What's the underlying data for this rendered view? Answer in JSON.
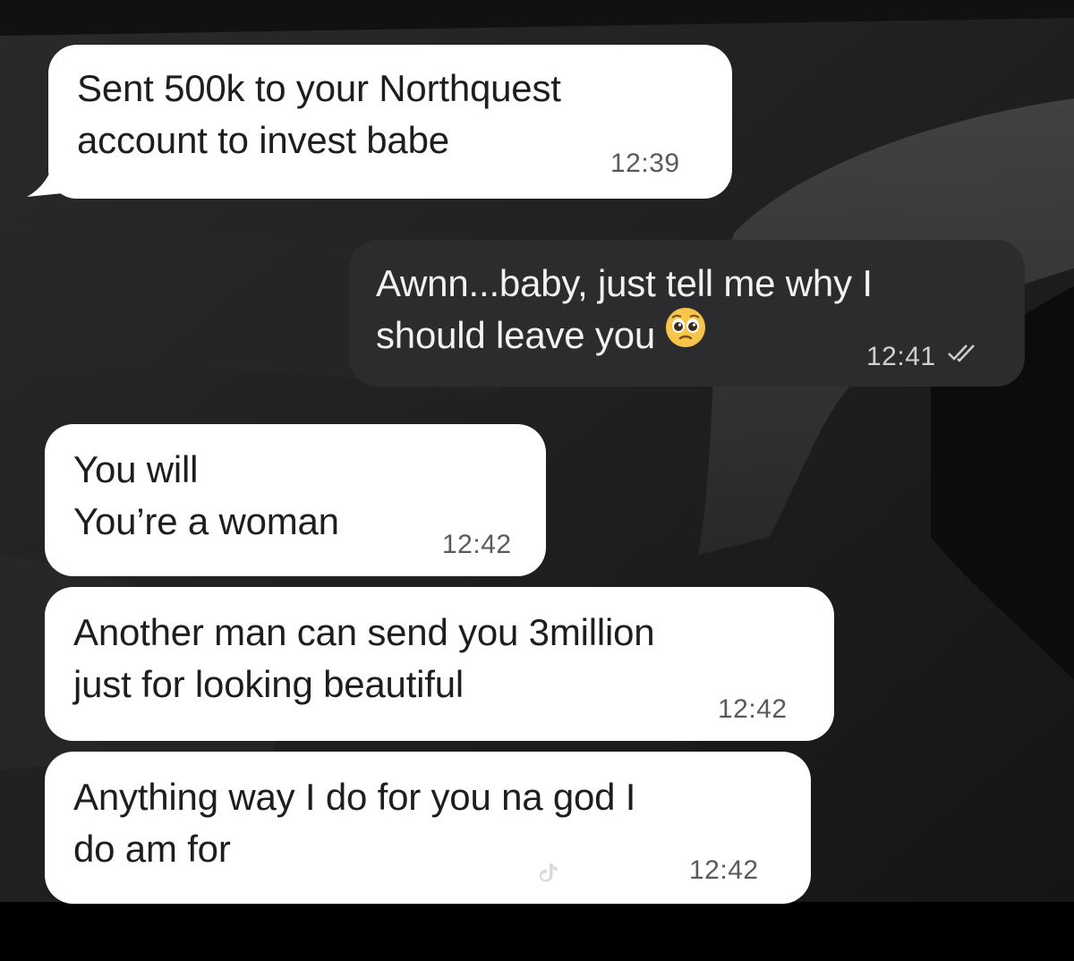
{
  "messages": [
    {
      "direction": "incoming",
      "lines": [
        "Sent 500k to your Northquest",
        "account to invest babe"
      ],
      "time": "12:39"
    },
    {
      "direction": "outgoing",
      "lines": [
        "Awnn...baby, just tell me why I",
        "should leave you"
      ],
      "emoji": "pleading-face",
      "time": "12:41",
      "status": "read"
    },
    {
      "direction": "incoming",
      "lines": [
        "You will",
        "You’re a woman"
      ],
      "time": "12:42"
    },
    {
      "direction": "incoming",
      "lines": [
        "Another man can send you 3million",
        "just for looking beautiful"
      ],
      "time": "12:42"
    },
    {
      "direction": "incoming",
      "lines": [
        "Anything way I do for you na god I",
        "do am for"
      ],
      "time": "12:42"
    }
  ],
  "colors": {
    "incoming_bubble": "#ffffff",
    "outgoing_bubble": "#2c2c2e",
    "wallpaper": "#1c1c1c"
  },
  "icons": [
    "pleading-face-emoji",
    "double-check-icon",
    "tiktok-icon"
  ]
}
